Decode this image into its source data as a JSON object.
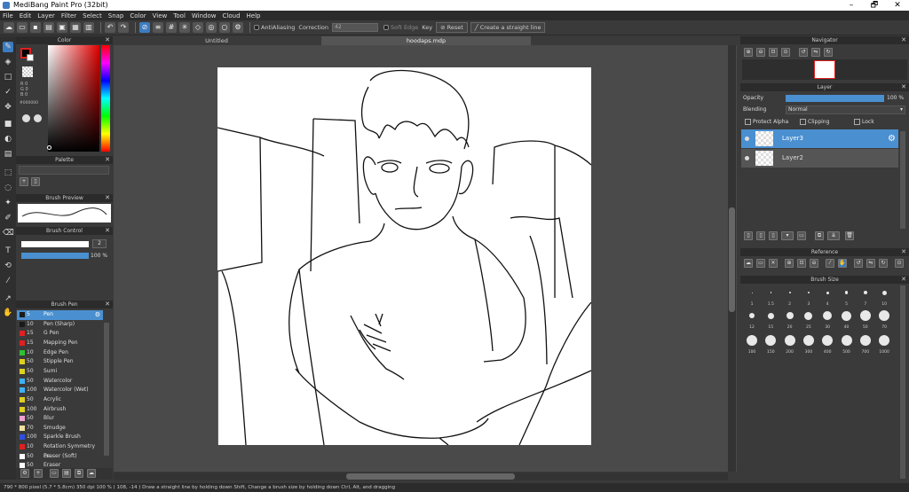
{
  "window": {
    "title": "MediBang Paint Pro (32bit)",
    "min": "–",
    "max": "🗗",
    "close": "✕"
  },
  "menu": [
    "File",
    "Edit",
    "Layer",
    "Filter",
    "Select",
    "Snap",
    "Color",
    "View",
    "Tool",
    "Window",
    "Cloud",
    "Help"
  ],
  "toolbar": {
    "antialiasing": "AntiAliasing",
    "correction_label": "Correction",
    "correction_value": "42",
    "soft_edge": "Soft Edge",
    "key_label": "Key",
    "reset_label": "Reset",
    "straight_line": "Create a straight line"
  },
  "color_panel": {
    "title": "Color",
    "r": "R 0",
    "g": "G 0",
    "b": "B 0",
    "hex": "#000000"
  },
  "palette_panel": {
    "title": "Palette"
  },
  "brush_preview_panel": {
    "title": "Brush Preview"
  },
  "brush_control_panel": {
    "title": "Brush Control",
    "size": "2",
    "opacity": "100 %"
  },
  "brush_panel": {
    "title": "Brush Pen",
    "items": [
      {
        "size": "5",
        "name": "Pen",
        "color": "#1a1a1a"
      },
      {
        "size": "10",
        "name": "Pen (Sharp)",
        "color": "#1a1a1a"
      },
      {
        "size": "15",
        "name": "G Pen",
        "color": "#e02020"
      },
      {
        "size": "15",
        "name": "Mapping Pen",
        "color": "#e02020"
      },
      {
        "size": "10",
        "name": "Edge Pen",
        "color": "#30c030"
      },
      {
        "size": "50",
        "name": "Stipple Pen",
        "color": "#e0d020"
      },
      {
        "size": "50",
        "name": "Sumi",
        "color": "#e0d020"
      },
      {
        "size": "50",
        "name": "Watercolor",
        "color": "#40b0f0"
      },
      {
        "size": "100",
        "name": "Watercolor (Wet)",
        "color": "#40b0f0"
      },
      {
        "size": "50",
        "name": "Acrylic",
        "color": "#e0d020"
      },
      {
        "size": "100",
        "name": "Airbrush",
        "color": "#e0d020"
      },
      {
        "size": "50",
        "name": "Blur",
        "color": "#f0a0d0"
      },
      {
        "size": "70",
        "name": "Smudge",
        "color": "#f0e0a0"
      },
      {
        "size": "100",
        "name": "Sparkle Brush",
        "color": "#3050e0"
      },
      {
        "size": "10",
        "name": "Rotation Symmetry Pe",
        "color": "#e02020"
      },
      {
        "size": "50",
        "name": "Eraser (Soft)",
        "color": "#ffffff"
      },
      {
        "size": "50",
        "name": "Eraser",
        "color": "#ffffff"
      }
    ]
  },
  "canvas": {
    "tab_untitled": "Untitled",
    "tab_file": "hoodaps.mdp"
  },
  "navigator_panel": {
    "title": "Navigator"
  },
  "layer_panel": {
    "title": "Layer",
    "opacity_label": "Opacity",
    "opacity_value": "100 %",
    "blending_label": "Blending",
    "blending_value": "Normal",
    "protect_alpha": "Protect Alpha",
    "clipping": "Clipping",
    "lock": "Lock",
    "layers": [
      {
        "name": "Layer3"
      },
      {
        "name": "Layer2"
      }
    ]
  },
  "reference_panel": {
    "title": "Reference"
  },
  "brush_size_panel": {
    "title": "Brush Size",
    "rows": [
      [
        "1",
        "1.5",
        "2",
        "3",
        "4",
        "5",
        "7",
        "10"
      ],
      [
        "12",
        "15",
        "20",
        "25",
        "30",
        "40",
        "50",
        "70"
      ],
      [
        "100",
        "150",
        "200",
        "300",
        "400",
        "500",
        "700",
        "1000"
      ]
    ]
  },
  "status": {
    "text": "790 * 800 pixel   (5.7 * 5.8cm)   350 dpi   100 %   ( 108, -14 )   Draw a straight line by holding down Shift, Change a brush size by holding down Ctrl, Alt, and dragging"
  }
}
